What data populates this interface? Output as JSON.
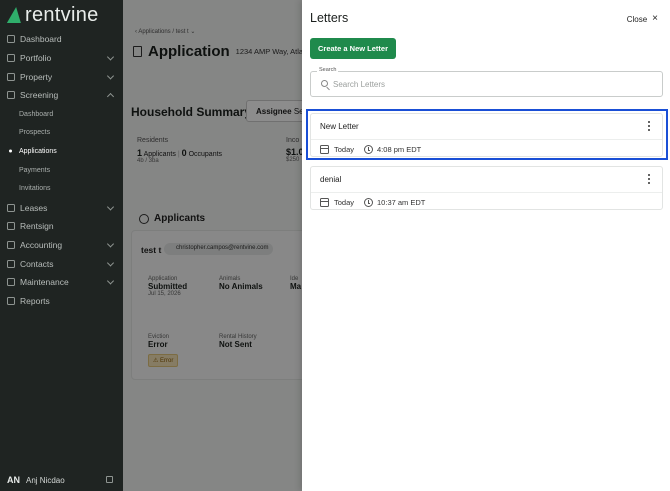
{
  "sidebar": {
    "brand": "rentvine",
    "items": [
      {
        "label": "Dashboard",
        "icon": "dashboard-icon",
        "expandable": false
      },
      {
        "label": "Portfolio",
        "icon": "portfolio-icon",
        "expandable": true
      },
      {
        "label": "Property",
        "icon": "property-icon",
        "expandable": true
      },
      {
        "label": "Screening",
        "icon": "screening-icon",
        "expandable": true,
        "expanded": true,
        "children": [
          {
            "label": "Dashboard"
          },
          {
            "label": "Prospects"
          },
          {
            "label": "Applications",
            "active": true
          },
          {
            "label": "Payments"
          },
          {
            "label": "Invitations"
          }
        ]
      },
      {
        "label": "Leases",
        "icon": "leases-icon",
        "expandable": true
      },
      {
        "label": "Rentsign",
        "icon": "rentsign-icon",
        "expandable": false
      },
      {
        "label": "Accounting",
        "icon": "accounting-icon",
        "expandable": true
      },
      {
        "label": "Contacts",
        "icon": "contacts-icon",
        "expandable": true
      },
      {
        "label": "Maintenance",
        "icon": "maintenance-icon",
        "expandable": true
      },
      {
        "label": "Reports",
        "icon": "reports-icon",
        "expandable": false
      }
    ],
    "user": {
      "initials": "AN",
      "name": "Anj Nicdao"
    }
  },
  "main": {
    "breadcrumb": "‹ Applications  /  test t ⌄",
    "title": "Application",
    "address": "1234 AMP Way, Atlan",
    "household_summary": "Household Summary",
    "assignee_label": "Assignee",
    "assignee_value": "Se",
    "residents_label": "Residents",
    "residents_applicants": "1",
    "residents_applicants_label": "Applicants",
    "residents_occupants": "0",
    "residents_occupants_label": "Occupants",
    "residents_beds": "4b / 3ba",
    "income_label": "Inco",
    "income_value": "$1.0",
    "income_sub": "$250",
    "applicants_heading": "Applicants",
    "applicant": {
      "name": "test t",
      "email": "christopher.campos@rentvine.com",
      "application_label": "Application",
      "application_value": "Submitted",
      "application_date": "Jul 15, 2026",
      "animals_label": "Animals",
      "animals_value": "No Animals",
      "id_label": "Ide",
      "id_value": "Ma",
      "eviction_label": "Eviction",
      "eviction_value": "Error",
      "eviction_badge": "Error",
      "rental_history_label": "Rental History",
      "rental_history_value": "Not Sent"
    }
  },
  "drawer": {
    "title": "Letters",
    "close_label": "Close",
    "create_button": "Create a New Letter",
    "search_label": "Search",
    "search_placeholder": "Search Letters",
    "search_value": "",
    "letters": [
      {
        "name": "New Letter",
        "date": "Today",
        "time": "4:08 pm EDT",
        "highlighted": true
      },
      {
        "name": "denial",
        "date": "Today",
        "time": "10:37 am EDT",
        "highlighted": false
      }
    ]
  },
  "colors": {
    "brand_green": "#1f8a4c",
    "sidebar_bg": "#1f2422",
    "highlight_blue": "#1a4fd6",
    "error_badge": "#f4e2b6"
  }
}
